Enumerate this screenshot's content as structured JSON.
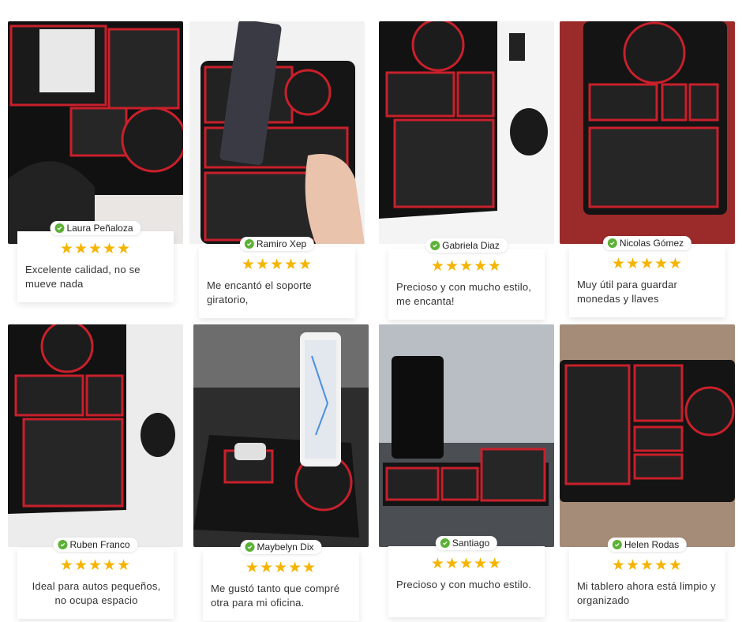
{
  "colors": {
    "accent_red": "#c8202b",
    "star": "#f5b400",
    "verified": "#5bb135"
  },
  "reviews": [
    {
      "name": "Laura Peñaloza",
      "rating": 5,
      "stars": "★★★★★",
      "text": "Excelente calidad, no se mueve nada"
    },
    {
      "name": "Ramiro Xep",
      "rating": 5,
      "stars": "★★★★★",
      "text": "Me encantó el soporte giratorio,"
    },
    {
      "name": "Gabriela Diaz",
      "rating": 5,
      "stars": "★★★★★",
      "text": "Precioso y con mucho estilo, me  encanta!"
    },
    {
      "name": "Nicolas Gómez",
      "rating": 5,
      "stars": "★★★★★",
      "text": "Muy útil para guardar monedas y llaves"
    },
    {
      "name": "Ruben Franco",
      "rating": 5,
      "stars": "★★★★★",
      "text": "Ideal para autos pequeños, no ocupa espacio"
    },
    {
      "name": "Maybelyn Dix",
      "rating": 5,
      "stars": "★★★★★",
      "text": "Me gustó tanto que compré otra para mi oficina."
    },
    {
      "name": "Santiago",
      "rating": 5,
      "stars": "★★★★★",
      "text": "Precioso y con mucho estilo."
    },
    {
      "name": "Helen Rodas",
      "rating": 5,
      "stars": "★★★★★",
      "text": "Mi tablero ahora está limpio y organizado"
    }
  ]
}
